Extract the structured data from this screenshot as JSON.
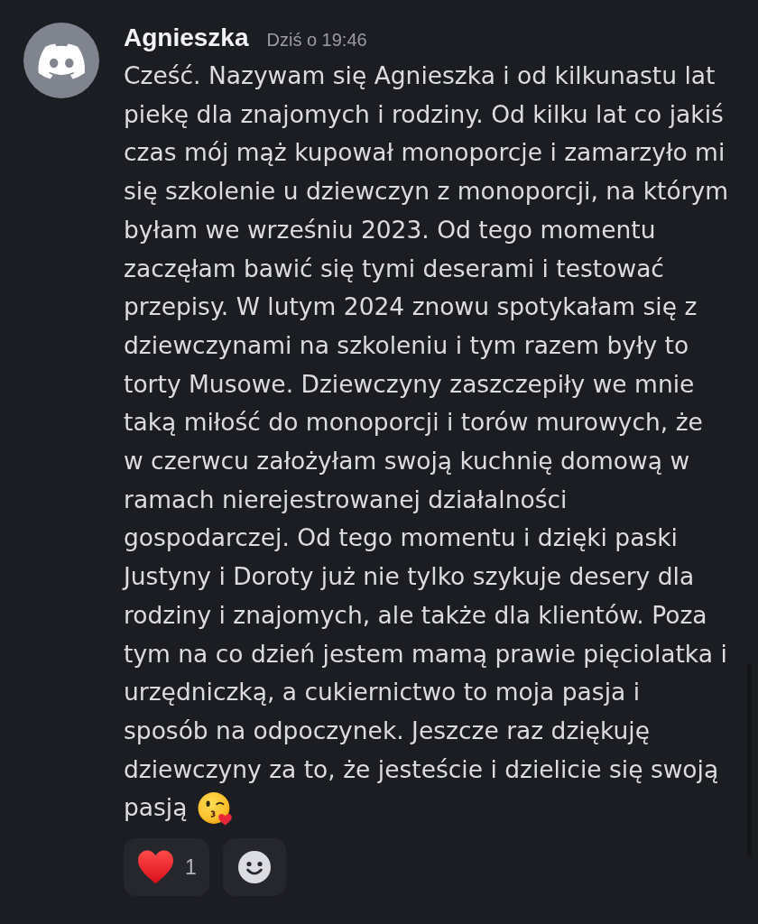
{
  "message": {
    "author": "Agnieszka",
    "timestamp": "Dziś o 19:46",
    "lines": [
      "Cześć. Nazywam się Agnieszka i od kilkunastu lat",
      "piekę dla znajomych i rodziny. Od kilku lat co jakiś",
      "czas mój mąż kupował monoporcje i zamarzyło mi",
      "się szkolenie u dziewczyn z monoporcji, na którym",
      "byłam we wrześniu 2023. Od tego momentu",
      "zaczęłam bawić się tymi deserami i testować",
      "przepisy. W lutym 2024 znowu spotykałam się z",
      "dziewczynami na szkoleniu i tym razem były to",
      "torty Musowe. Dziewczyny zaszczepiły we mnie",
      "taką miłość do monoporcji i torów murowych, że",
      "w czerwcu założyłam swoją kuchnię domową w",
      "ramach nierejestrowanej działalności",
      "gospodarczej. Od tego momentu i dzięki paski",
      "Justyny i Doroty już nie tylko szykuje desery dla",
      "rodziny i znajomych, ale także dla klientów. Poza",
      "tym na co dzień jestem mamą prawie pięciolatka i",
      "urzędniczką, a cukiernictwo to moja pasja i",
      "sposób na odpoczynek. Jeszcze raz dziękuję",
      "dziewczyny za to, że jesteście i dzielicie się swoją",
      "pasją"
    ]
  },
  "reactions": [
    {
      "kind": "emoji",
      "count": "1"
    },
    {
      "kind": "add"
    }
  ]
}
